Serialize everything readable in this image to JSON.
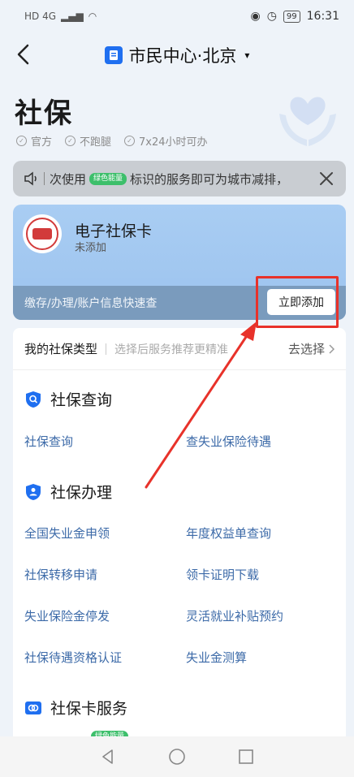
{
  "status_bar": {
    "network": "HD 4G",
    "battery": "99",
    "time": "16:31"
  },
  "header": {
    "title": "市民中心·北京",
    "caret": "▾"
  },
  "page": {
    "title": "社保",
    "badges": [
      "官方",
      "不跑腿",
      "7x24小时可办"
    ]
  },
  "notice": {
    "prefix": "次使用",
    "tag": "绿色能量",
    "text": "标识的服务即可为城市减排，"
  },
  "card": {
    "name": "电子社保卡",
    "status": "未添加",
    "bottom_text": "缴存/办理/账户信息快速查",
    "add_button": "立即添加"
  },
  "type_row": {
    "label": "我的社保类型",
    "hint": "选择后服务推荐更精准",
    "action": "去选择"
  },
  "sections": [
    {
      "title": "社保查询",
      "icon": "search-shield-icon",
      "items": [
        "社保查询",
        "查失业保险待遇"
      ]
    },
    {
      "title": "社保办理",
      "icon": "person-shield-icon",
      "items": [
        "全国失业金申领",
        "年度权益单查询",
        "社保转移申请",
        "领卡证明下载",
        "失业保险金停发",
        "灵活就业补贴预约",
        "社保待遇资格认证",
        "失业金测算"
      ]
    },
    {
      "title": "社保卡服务",
      "icon": "card-icon",
      "items": []
    }
  ],
  "partial_tag": "绿色能量",
  "colors": {
    "accent": "#1f6ff0",
    "link": "#3c6aa8",
    "highlight": "#e8322a",
    "green": "#3dbf6b"
  }
}
